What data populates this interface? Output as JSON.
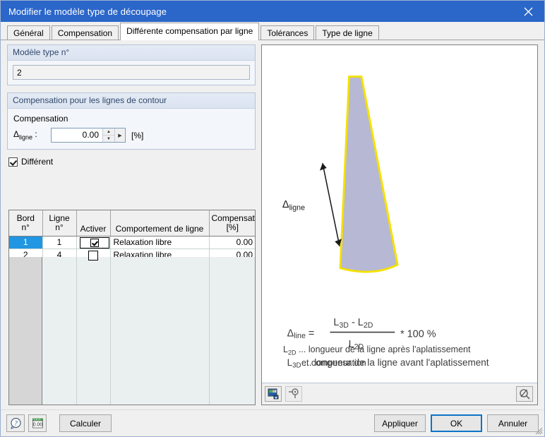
{
  "window": {
    "title": "Modifier le modèle type de découpage",
    "close_icon": "close-icon"
  },
  "tabs": [
    {
      "label": "Général",
      "active": false
    },
    {
      "label": "Compensation",
      "active": false
    },
    {
      "label": "Différente compensation par ligne",
      "active": true
    },
    {
      "label": "Tolérances",
      "active": false
    },
    {
      "label": "Type de ligne",
      "active": false
    }
  ],
  "model_group": {
    "header": "Modèle type n°",
    "value": "2"
  },
  "compensation_group": {
    "header": "Compensation pour les lignes de contour",
    "subtitle": "Compensation",
    "delta_label": "Δ",
    "delta_sub": "ligne",
    "delta_colon": " :",
    "value": "0.00",
    "unit": "[%]"
  },
  "different_checkbox": {
    "label": "Différent",
    "checked": true
  },
  "table": {
    "headers": [
      {
        "line1": "Bord",
        "line2": "n°"
      },
      {
        "line1": "Ligne",
        "line2": "n°"
      },
      {
        "line1": "",
        "line2": "Activer"
      },
      {
        "line1": "",
        "line2": "Comportement de ligne"
      },
      {
        "line1": "Compensation",
        "line2": "[%]"
      }
    ],
    "rows": [
      {
        "bord": "1",
        "ligne": "1",
        "activer": true,
        "comportement": "Relaxation libre",
        "compensation": "0.00",
        "selected": true
      },
      {
        "bord": "2",
        "ligne": "4",
        "activer": false,
        "comportement": "Relaxation libre",
        "compensation": "0.00",
        "selected": false
      }
    ]
  },
  "preview": {
    "shape_label_delta": "Δ",
    "shape_label_sub": "ligne",
    "shape_fill": "#b7b8d4",
    "shape_stroke": "#f5e100",
    "formula": {
      "lhs_delta": "Δ",
      "lhs_sub": "line",
      "equals": "=",
      "numerator_a": "L",
      "numerator_a_sub": "3D",
      "minus": "-",
      "numerator_b": "L",
      "numerator_b_sub": "2D",
      "denominator": "L",
      "denominator_sub": "2D",
      "tail": "* 100 %"
    },
    "legend": [
      {
        "symbol": "L",
        "sub": "3D",
        "dots": "...",
        "text": "longueur de la ligne avant l'aplatissement",
        "text2": ""
      },
      {
        "symbol": "L",
        "sub": "2D",
        "dots": "...",
        "text": "longueur de la ligne après l'aplatissement",
        "text2": "et compensation"
      }
    ],
    "toolbar": {
      "render_icon": "render-image-icon",
      "visibility_icon": "visibility-toggle-icon",
      "zoom_icon": "zoom-reset-icon"
    }
  },
  "bottom_bar": {
    "help_icon": "help-icon",
    "units_icon": "units-icon",
    "calculate": "Calculer",
    "apply": "Appliquer",
    "ok": "OK",
    "cancel": "Annuler"
  }
}
